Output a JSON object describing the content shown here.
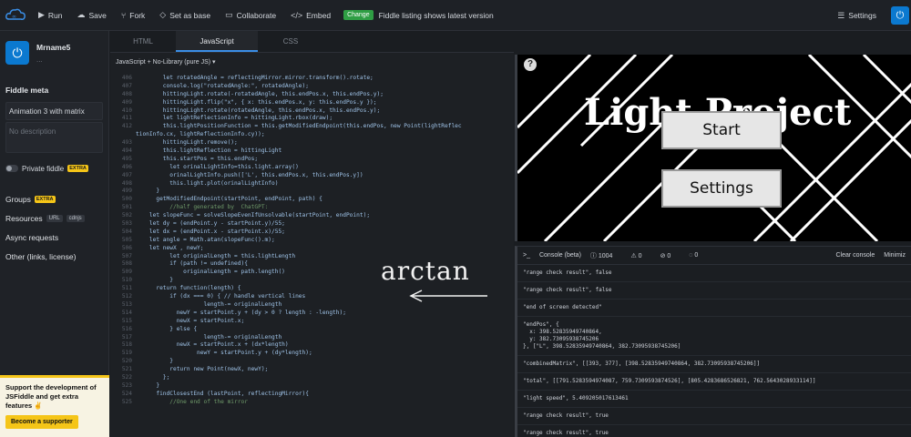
{
  "topbar": {
    "run": "Run",
    "save": "Save",
    "fork": "Fork",
    "set_as_base": "Set as base",
    "collaborate": "Collaborate",
    "embed": "Embed",
    "change_badge": "Change",
    "change_msg": "Fiddle listing shows latest version",
    "settings": "Settings"
  },
  "sidebar": {
    "username": "Mrname5",
    "username_sub": "...",
    "meta_heading": "Fiddle meta",
    "title_value": "Animation 3 with matrix",
    "description_placeholder": "No description",
    "private_label": "Private fiddle",
    "extra": "EXTRA",
    "groups": "Groups",
    "resources": "Resources",
    "url_tag": "URL",
    "cdnjs_tag": "cdnjs",
    "async_requests": "Async requests",
    "other_links": "Other (links, license)",
    "support_text": "Support the development of JSFiddle and get extra features ✌",
    "supporter_button": "Become a supporter"
  },
  "editor": {
    "tabs": [
      "HTML",
      "JavaScript",
      "CSS"
    ],
    "lib_line": "JavaScript + No-Library (pure JS) ▾",
    "code_lines": [
      [
        "406",
        "        let rotatedAngle = reflectingMirror.mirror.transform().rotate;"
      ],
      [
        "407",
        "        console.log(\"rotatedAngle:\", rotatedAngle);"
      ],
      [
        "408",
        "        hittingLight.rotate(-rotatedAngle, this.endPos.x, this.endPos.y);"
      ],
      [
        "409",
        "        hittingLight.flip(\"x\", { x: this.endPos.x, y: this.endPos.y });"
      ],
      [
        "410",
        "        hittingLight.rotate(rotatedAngle, this.endPos.x, this.endPos.y);"
      ],
      [
        "411",
        "        let lightReflectionInfo = hittingLight.rbox(draw);"
      ],
      [
        "412",
        "        this.lightPositionFunction = this.getModifiedEndpoint(this.endPos, new Point(lightReflec"
      ],
      [
        "",
        "tionInfo.cx, lightReflectionInfo.cy));"
      ],
      [
        "493",
        "        hittingLight.remove();"
      ],
      [
        "494",
        "        this.lightReflection = hittingLight"
      ],
      [
        "495",
        "        this.startPos = this.endPos;"
      ],
      [
        "496",
        "          let orinalLightInfo=this.light.array()"
      ],
      [
        "497",
        "          orinalLightInfo.push(['L', this.endPos.x, this.endPos.y])"
      ],
      [
        "498",
        "          this.light.plot(orinalLightInfo)"
      ],
      [
        "499",
        "      }"
      ],
      [
        "500",
        "      getModifiedEndpoint(startPoint, endPoint, path) {"
      ],
      [
        "501",
        "          //half generated by  ChatGPT:"
      ],
      [
        "502",
        "    let slopeFunc = solveSlopeEvenIfUnsolvable(startPoint, endPoint);"
      ],
      [
        "503",
        "    let dy = (endPoint.y - startPoint.y)/55;"
      ],
      [
        "504",
        "    let dx = (endPoint.x - startPoint.x)/55;"
      ],
      [
        "505",
        "    let angle = Math.atan(slopeFunc().m);"
      ],
      [
        "506",
        "    let newX , newY;"
      ],
      [
        "507",
        "          let originalLength = this.lightLength"
      ],
      [
        "508",
        "          if (path != undefined){"
      ],
      [
        "509",
        "              originalLength = path.length()"
      ],
      [
        "510",
        "          }"
      ],
      [
        "511",
        "      return function(length) {"
      ],
      [
        "512",
        "          if (dx === 0) { // handle vertical lines"
      ],
      [
        "513",
        "                    length-= originalLength"
      ],
      [
        "514",
        "            newY = startPoint.y + (dy > 0 ? length : -length);"
      ],
      [
        "515",
        "            newX = startPoint.x;"
      ],
      [
        "516",
        "          } else {"
      ],
      [
        "517",
        "                    length-= originalLength"
      ],
      [
        "518",
        "            newX = startPoint.x + (dx*length)"
      ],
      [
        "519",
        "                  newY = startPoint.y + (dy*length);"
      ],
      [
        "520",
        "          }"
      ],
      [
        "521",
        "          return new Point(newX, newY);"
      ],
      [
        "522",
        "        };"
      ],
      [
        "523",
        "      }"
      ],
      [
        "524",
        "      findClosestEnd (lastPoint, reflectingMirror){"
      ],
      [
        "525",
        "          //One end of the mirror"
      ]
    ],
    "annotation": "arctan"
  },
  "result": {
    "title": "Light Project",
    "start_button": "Start",
    "settings_button": "Settings",
    "help": "?"
  },
  "console": {
    "title": "Console (beta)",
    "count_info": "1004",
    "count_warn": "0",
    "count_err": "0",
    "count_other": "0",
    "clear": "Clear console",
    "minimize": "Minimiz",
    "lines": [
      "\"range check result\", false",
      "\"range check result\", false",
      "\"end of screen detected\"",
      "\"endPos\", {\n  x: 398.52835949740864,\n  y: 382.73095938745206\n}, [\"L\", 398.52835949740864, 382.73095938745206]",
      "\"combinedMatrix\", [[393, 377], [398.52835949740864, 382.73095938745206]]",
      "\"total\", [[791.5283594974087, 759.7309593874526], [805.4283686526821, 762.5643028933114]]",
      "\"light speed\", 5.409205017613461",
      "\"range check result\", true",
      "\"range check result\", true"
    ]
  }
}
